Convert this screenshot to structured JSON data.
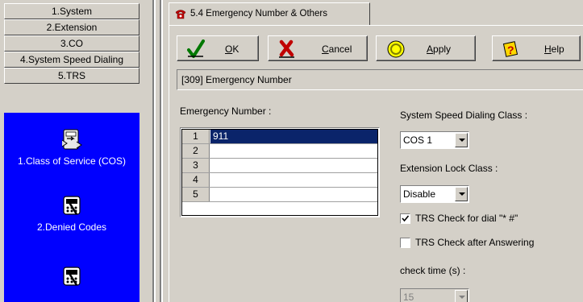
{
  "nav": {
    "items": [
      {
        "label": "1.System"
      },
      {
        "label": "2.Extension"
      },
      {
        "label": "3.CO"
      },
      {
        "label": "4.System Speed Dialing"
      },
      {
        "label": "5.TRS"
      }
    ],
    "panel": [
      {
        "label": "1.Class of Service (COS)",
        "icon": "cos-icon"
      },
      {
        "label": "2.Denied Codes",
        "icon": "denied-codes-icon"
      },
      {
        "label": "",
        "icon": "allowed-codes-icon"
      }
    ],
    "panel_color": "#0000ff"
  },
  "tab": {
    "label": "5.4 Emergency Number & Others",
    "icon": "telephone-icon"
  },
  "toolbar": {
    "ok_label": "OK",
    "cancel_label": "Cancel",
    "apply_label": "Apply",
    "help_label": "Help"
  },
  "section_title": "[309] Emergency Number",
  "emergency": {
    "label": "Emergency Number :",
    "rows": [
      {
        "num": "1",
        "value": "911"
      },
      {
        "num": "2",
        "value": ""
      },
      {
        "num": "3",
        "value": ""
      },
      {
        "num": "4",
        "value": ""
      },
      {
        "num": "5",
        "value": ""
      }
    ]
  },
  "settings": {
    "speed_dial_label": "System Speed Dialing Class :",
    "speed_dial_value": "COS 1",
    "ext_lock_label": "Extension Lock Class :",
    "ext_lock_value": "Disable",
    "trs_dial_label": "TRS Check for dial \"* #\"",
    "trs_dial_checked": true,
    "trs_answer_label": "TRS Check after Answering",
    "trs_answer_checked": false,
    "check_time_label": "check time (s) :",
    "check_time_value": "15"
  }
}
